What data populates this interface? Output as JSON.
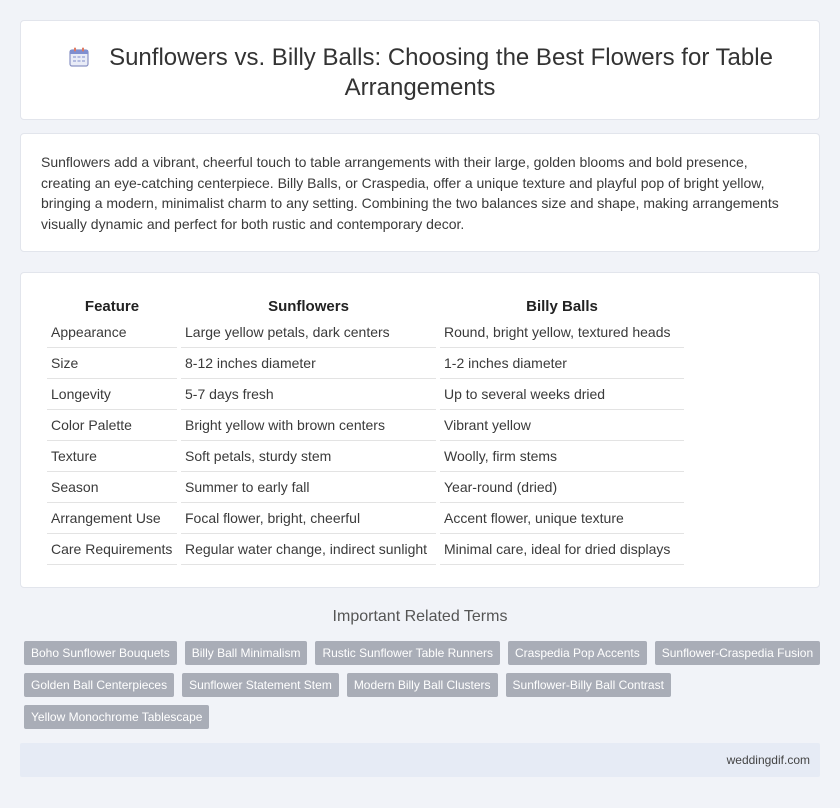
{
  "header": {
    "title": "Sunflowers vs. Billy Balls: Choosing the Best Flowers for Table Arrangements",
    "icon": "calendar-icon"
  },
  "intro": {
    "text": "Sunflowers add a vibrant, cheerful touch to table arrangements with their large, golden blooms and bold presence, creating an eye-catching centerpiece. Billy Balls, or Craspedia, offer a unique texture and playful pop of bright yellow, bringing a modern, minimalist charm to any setting. Combining the two balances size and shape, making arrangements visually dynamic and perfect for both rustic and contemporary decor."
  },
  "table": {
    "headers": [
      "Feature",
      "Sunflowers",
      "Billy Balls"
    ],
    "rows": [
      [
        "Appearance",
        "Large yellow petals, dark centers",
        "Round, bright yellow, textured heads"
      ],
      [
        "Size",
        "8-12 inches diameter",
        "1-2 inches diameter"
      ],
      [
        "Longevity",
        "5-7 days fresh",
        "Up to several weeks dried"
      ],
      [
        "Color Palette",
        "Bright yellow with brown centers",
        "Vibrant yellow"
      ],
      [
        "Texture",
        "Soft petals, sturdy stem",
        "Woolly, firm stems"
      ],
      [
        "Season",
        "Summer to early fall",
        "Year-round (dried)"
      ],
      [
        "Arrangement Use",
        "Focal flower, bright, cheerful",
        "Accent flower, unique texture"
      ],
      [
        "Care Requirements",
        "Regular water change, indirect sunlight",
        "Minimal care, ideal for dried displays"
      ]
    ]
  },
  "related": {
    "title": "Important Related Terms",
    "tags": [
      "Boho Sunflower Bouquets",
      "Billy Ball Minimalism",
      "Rustic Sunflower Table Runners",
      "Craspedia Pop Accents",
      "Sunflower-Craspedia Fusion",
      "Golden Ball Centerpieces",
      "Sunflower Statement Stem",
      "Modern Billy Ball Clusters",
      "Sunflower-Billy Ball Contrast",
      "Yellow Monochrome Tablescape"
    ]
  },
  "footer": {
    "site": "weddingdif.com"
  },
  "colors": {
    "background": "#f1f3f8",
    "tag": "#a9adb7",
    "footer": "#e6ebf5"
  }
}
